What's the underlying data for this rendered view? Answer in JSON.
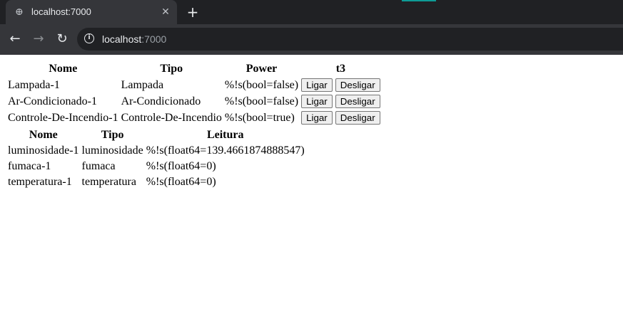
{
  "browser": {
    "tab_title": "localhost:7000",
    "close_glyph": "✕",
    "new_tab_glyph": "+",
    "url_host": "localhost",
    "url_port": ":7000",
    "info_glyph": "i",
    "icons": [
      "globe-icon",
      "close-icon",
      "plus-icon",
      "back-arrow-icon",
      "forward-arrow-icon",
      "reload-icon",
      "info-icon"
    ],
    "back_glyph": "←",
    "forward_glyph": "→",
    "reload_glyph": "↻",
    "globe_glyph": "⊕"
  },
  "actuators": {
    "headers": {
      "nome": "Nome",
      "tipo": "Tipo",
      "power": "Power",
      "t3": "t3"
    },
    "rows": [
      {
        "nome": "Lampada-1",
        "tipo": "Lampada",
        "power": "%!s(bool=false)",
        "on_label": "Ligar",
        "off_label": "Desligar"
      },
      {
        "nome": "Ar-Condicionado-1",
        "tipo": "Ar-Condicionado",
        "power": "%!s(bool=false)",
        "on_label": "Ligar",
        "off_label": "Desligar"
      },
      {
        "nome": "Controle-De-Incendio-1",
        "tipo": "Controle-De-Incendio",
        "power": "%!s(bool=true)",
        "on_label": "Ligar",
        "off_label": "Desligar"
      }
    ]
  },
  "sensors": {
    "headers": {
      "nome": "Nome",
      "tipo": "Tipo",
      "leitura": "Leitura"
    },
    "rows": [
      {
        "nome": "luminosidade-1",
        "tipo": "luminosidade",
        "leitura": "%!s(float64=139.4661874888547)"
      },
      {
        "nome": "fumaca-1",
        "tipo": "fumaca",
        "leitura": "%!s(float64=0)"
      },
      {
        "nome": "temperatura-1",
        "tipo": "temperatura",
        "leitura": "%!s(float64=0)"
      }
    ]
  },
  "colors": {
    "tabstrip": "#202124",
    "toolbar": "#35363a",
    "accent": "#0e9b96"
  }
}
